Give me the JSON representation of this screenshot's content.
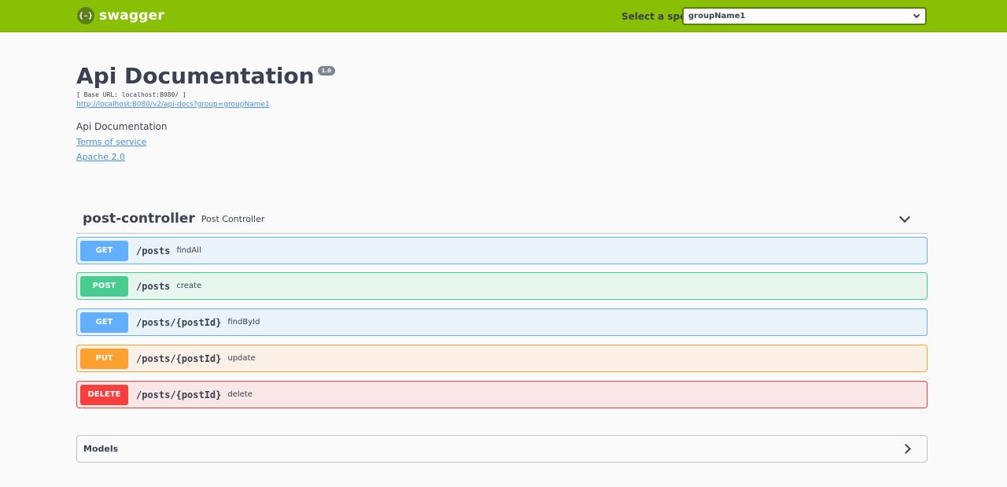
{
  "topbar": {
    "logo_glyph": "{-}",
    "brand": "swagger",
    "select_label": "Select a spec",
    "selected_spec": "groupName1",
    "color": "#89bf04"
  },
  "info": {
    "title": "Api Documentation",
    "version": "1.0",
    "base_url": "[ Base URL: localhost:8080/ ]",
    "spec_url": "http://localhost:8080/v2/api-docs?group=groupName1",
    "description": "Api Documentation",
    "terms": "Terms of service",
    "license": "Apache 2.0"
  },
  "tag": {
    "name": "post-controller",
    "description": "Post Controller",
    "expanded_icon": "chevron-down-icon"
  },
  "operations": [
    {
      "method": "GET",
      "path": "/posts",
      "summary": "findAll",
      "color": "#61affe"
    },
    {
      "method": "POST",
      "path": "/posts",
      "summary": "create",
      "color": "#49cc90"
    },
    {
      "method": "GET",
      "path": "/posts/{postId}",
      "summary": "findById",
      "color": "#61affe"
    },
    {
      "method": "PUT",
      "path": "/posts/{postId}",
      "summary": "update",
      "color": "#fca130"
    },
    {
      "method": "DELETE",
      "path": "/posts/{postId}",
      "summary": "delete",
      "color": "#f93e3e"
    }
  ],
  "models": {
    "title": "Models",
    "collapsed_icon": "chevron-right-icon"
  }
}
